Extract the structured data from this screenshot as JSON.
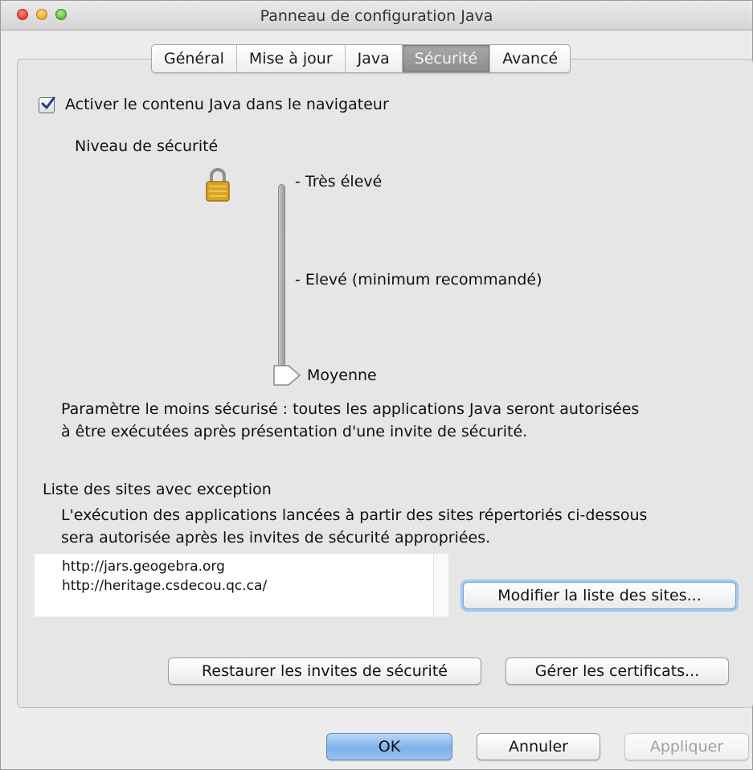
{
  "window": {
    "title": "Panneau de configuration Java"
  },
  "tabs": [
    {
      "label": "Général"
    },
    {
      "label": "Mise à jour"
    },
    {
      "label": "Java"
    },
    {
      "label": "Sécurité",
      "active": true
    },
    {
      "label": "Avancé"
    }
  ],
  "security": {
    "enable_java_label": "Activer le contenu Java dans le navigateur",
    "enable_java_checked": true,
    "level_heading": "Niveau de sécurité",
    "levels": [
      "Très élevé",
      "Elevé (minimum recommandé)",
      "Moyenne"
    ],
    "selected_level": "Moyenne",
    "level_description_line1": "Paramètre le moins sécurisé : toutes les applications Java seront autorisées",
    "level_description_line2": "à être exécutées après présentation d'une invite de sécurité."
  },
  "exceptions": {
    "heading": "Liste des sites avec exception",
    "description_line1": "L'exécution des applications lancées à partir des sites répertoriés ci-dessous",
    "description_line2": "sera autorisée après les invites de sécurité appropriées.",
    "sites": [
      "http://jars.geogebra.org",
      "http://heritage.csdecou.qc.ca/"
    ],
    "edit_button": "Modifier la liste des sites..."
  },
  "actions": {
    "restore_prompts": "Restaurer les invites de sécurité",
    "manage_certificates": "Gérer les certificats..."
  },
  "footer": {
    "ok": "OK",
    "cancel": "Annuler",
    "apply": "Appliquer"
  },
  "colors": {
    "default_button": "#7fb1ea",
    "active_tab": "#9a9a9a",
    "lock_icon": "#d9a421"
  }
}
